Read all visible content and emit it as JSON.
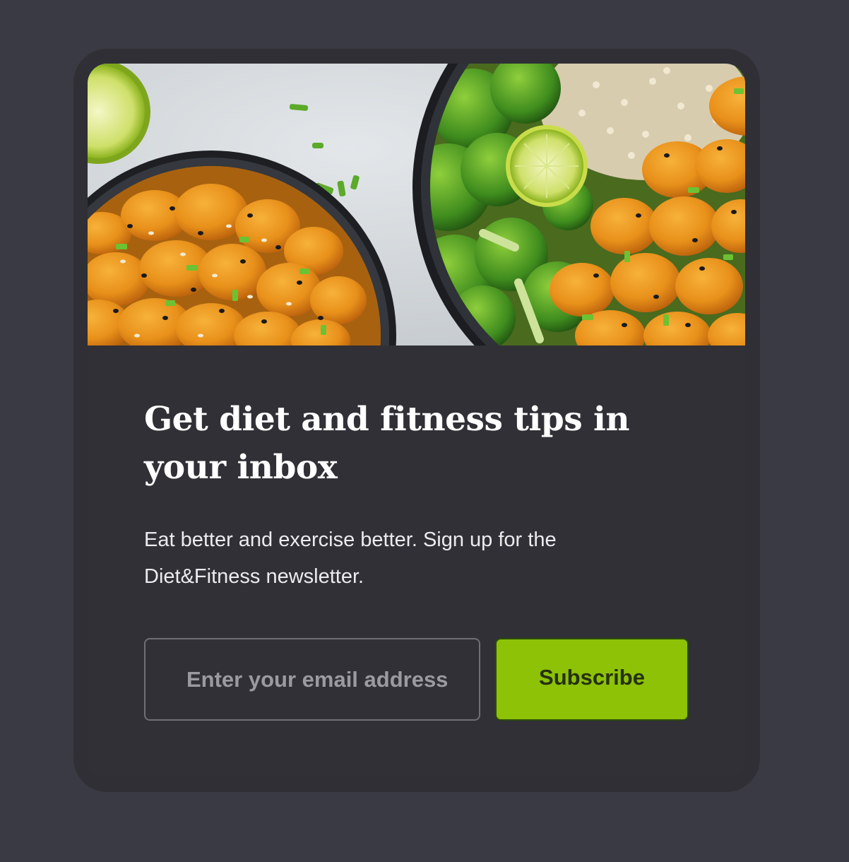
{
  "hero": {
    "image_alt": "Meal prep bowls with sesame chicken, broccoli, quinoa and lime"
  },
  "newsletter": {
    "headline": "Get diet and fitness tips in your inbox",
    "description": "Eat better and exercise better. Sign up for the Diet&Fitness newsletter.",
    "email_placeholder": "Enter your email address",
    "email_value": "",
    "subscribe_label": "Subscribe"
  },
  "colors": {
    "page_background": "#3a3a44",
    "card_background": "#2f2f35",
    "accent": "#8dc207"
  }
}
